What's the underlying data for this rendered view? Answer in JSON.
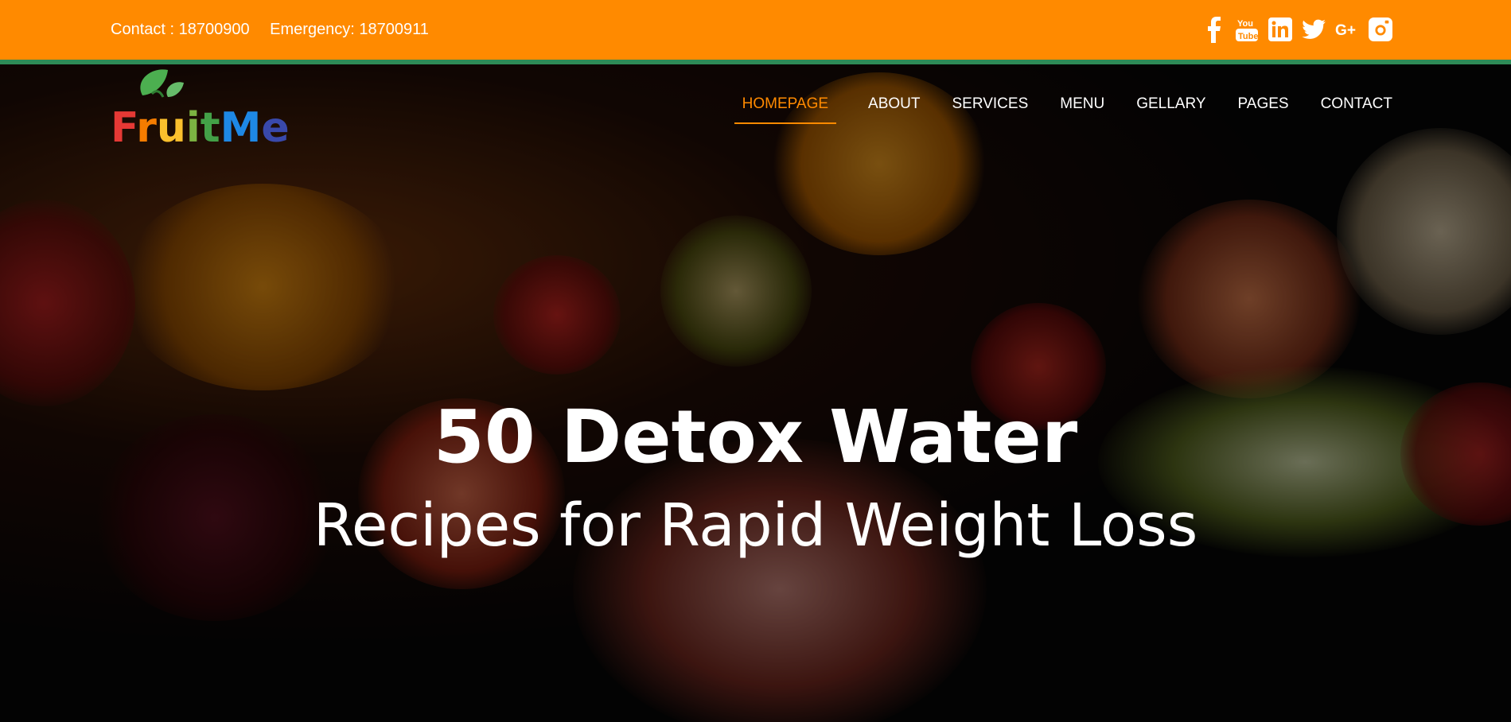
{
  "topbar": {
    "contact": "Contact : 18700900",
    "emergency": "Emergency: 18700911"
  },
  "social": [
    "facebook-icon",
    "youtube-icon",
    "linkedin-icon",
    "twitter-icon",
    "google-plus-icon",
    "instagram-icon"
  ],
  "brand": {
    "logo_text": "FruitMe"
  },
  "nav": {
    "items": [
      "HOMEPAGE",
      "ABOUT",
      "SERVICES",
      "MENU",
      "GELLARY",
      "PAGES",
      "CONTACT"
    ],
    "active": "HOMEPAGE"
  },
  "hero": {
    "title": "50 Detox Water",
    "subtitle": "Recipes for Rapid Weight Loss"
  },
  "colors": {
    "accent": "#ff8a00",
    "divider": "#2e8b57"
  }
}
